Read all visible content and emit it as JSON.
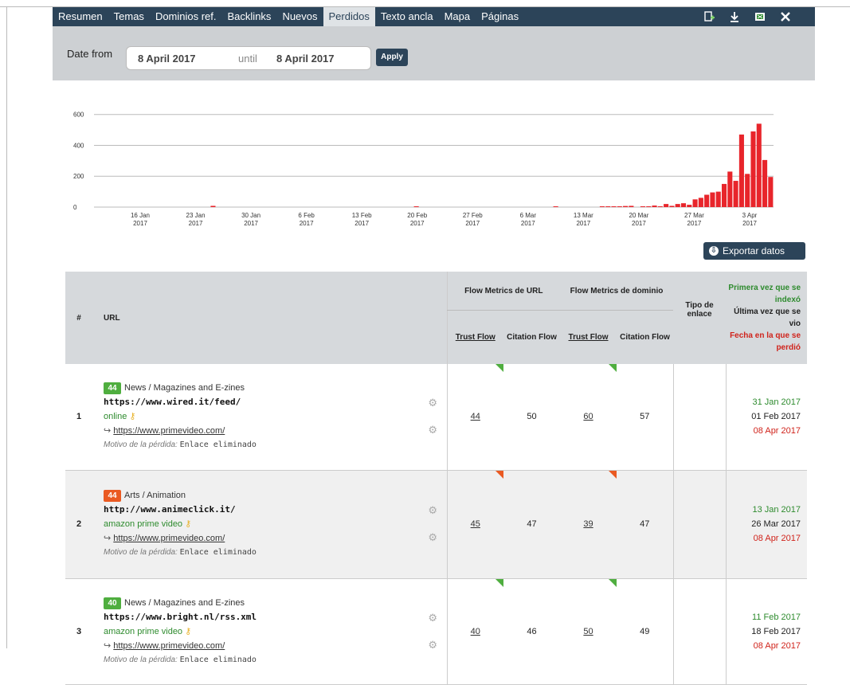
{
  "nav": {
    "tabs": [
      "Resumen",
      "Temas",
      "Dominios ref.",
      "Backlinks",
      "Nuevos",
      "Perdidos",
      "Texto ancla",
      "Mapa",
      "Páginas"
    ],
    "active": "Perdidos",
    "icons": [
      "add-icon",
      "download-icon",
      "export-excel-icon",
      "tools-icon"
    ]
  },
  "date_filter": {
    "label": "Date from",
    "from": "8 April 2017",
    "until_label": "until",
    "to": "8 April 2017",
    "apply_label": "Apply"
  },
  "chart_data": {
    "type": "bar",
    "y_ticks": [
      0,
      200,
      400,
      600
    ],
    "ylim": [
      0,
      650
    ],
    "x_tick_labels": [
      "16 Jan 2017",
      "23 Jan 2017",
      "30 Jan 2017",
      "6 Feb 2017",
      "13 Feb 2017",
      "20 Feb 2017",
      "27 Feb 2017",
      "6 Mar 2017",
      "13 Mar 2017",
      "20 Mar 2017",
      "27 Mar 2017",
      "3 Apr 2017"
    ],
    "bar_color": "#e8252b",
    "grid": true,
    "values": [
      0,
      0,
      0,
      0,
      0,
      0,
      0,
      0,
      0,
      0,
      0,
      0,
      0,
      0,
      0,
      0,
      0,
      0,
      0,
      0,
      8,
      0,
      0,
      0,
      0,
      0,
      0,
      0,
      0,
      0,
      0,
      0,
      0,
      0,
      0,
      0,
      0,
      0,
      0,
      0,
      0,
      0,
      0,
      0,
      0,
      0,
      0,
      0,
      0,
      0,
      0,
      0,
      0,
      0,
      0,
      5,
      0,
      0,
      0,
      0,
      0,
      0,
      0,
      0,
      0,
      0,
      0,
      0,
      0,
      0,
      0,
      0,
      0,
      0,
      0,
      0,
      0,
      0,
      0,
      5,
      0,
      0,
      0,
      0,
      0,
      0,
      0,
      5,
      5,
      5,
      5,
      7,
      8,
      0,
      5,
      5,
      10,
      5,
      20,
      8,
      20,
      25,
      15,
      50,
      60,
      80,
      95,
      100,
      150,
      230,
      170,
      470,
      215,
      490,
      540,
      305,
      195
    ]
  },
  "export": {
    "label": "Exportar datos"
  },
  "table": {
    "headers": {
      "num": "#",
      "url": "URL",
      "flow_url": "Flow Metrics de URL",
      "flow_domain": "Flow Metrics de dominio",
      "trust_flow": "Trust Flow",
      "citation_flow": "Citation Flow",
      "tipo": "Tipo de enlace",
      "first_seen": "Primera vez que se indexó",
      "last_seen": "Última vez que se vio",
      "lost_date": "Fecha en la que se perdió"
    },
    "reason_label": "Motivo de la pérdida:",
    "rows": [
      {
        "num": "1",
        "badge": "44",
        "badge_color": "green",
        "category": "News / Magazines and E-zines",
        "url": "https://www.wired.it/feed/",
        "anchor": "online",
        "target": "https://www.primevideo.com/",
        "reason": "Enlace eliminado",
        "tf_url": "44",
        "cf_url": "50",
        "tf_dom": "60",
        "cf_dom": "57",
        "flag_url": "green",
        "flag_dom": "green",
        "first": "31 Jan 2017",
        "last": "01 Feb 2017",
        "lost": "08 Apr 2017"
      },
      {
        "num": "2",
        "badge": "44",
        "badge_color": "orange",
        "category": "Arts / Animation",
        "url": "http://www.animeclick.it/",
        "anchor": "amazon prime video",
        "target": "https://www.primevideo.com/",
        "reason": "Enlace eliminado",
        "tf_url": "45",
        "cf_url": "47",
        "tf_dom": "39",
        "cf_dom": "47",
        "flag_url": "orange",
        "flag_dom": "orange",
        "first": "13 Jan 2017",
        "last": "26 Mar 2017",
        "lost": "08 Apr 2017"
      },
      {
        "num": "3",
        "badge": "40",
        "badge_color": "green",
        "category": "News / Magazines and E-zines",
        "url": "https://www.bright.nl/rss.xml",
        "anchor": "amazon prime video",
        "target": "https://www.primevideo.com/",
        "reason": "Enlace eliminado",
        "tf_url": "40",
        "cf_url": "46",
        "tf_dom": "50",
        "cf_dom": "49",
        "flag_url": "green",
        "flag_dom": "green",
        "first": "11 Feb 2017",
        "last": "18 Feb 2017",
        "lost": "08 Apr 2017"
      }
    ]
  }
}
